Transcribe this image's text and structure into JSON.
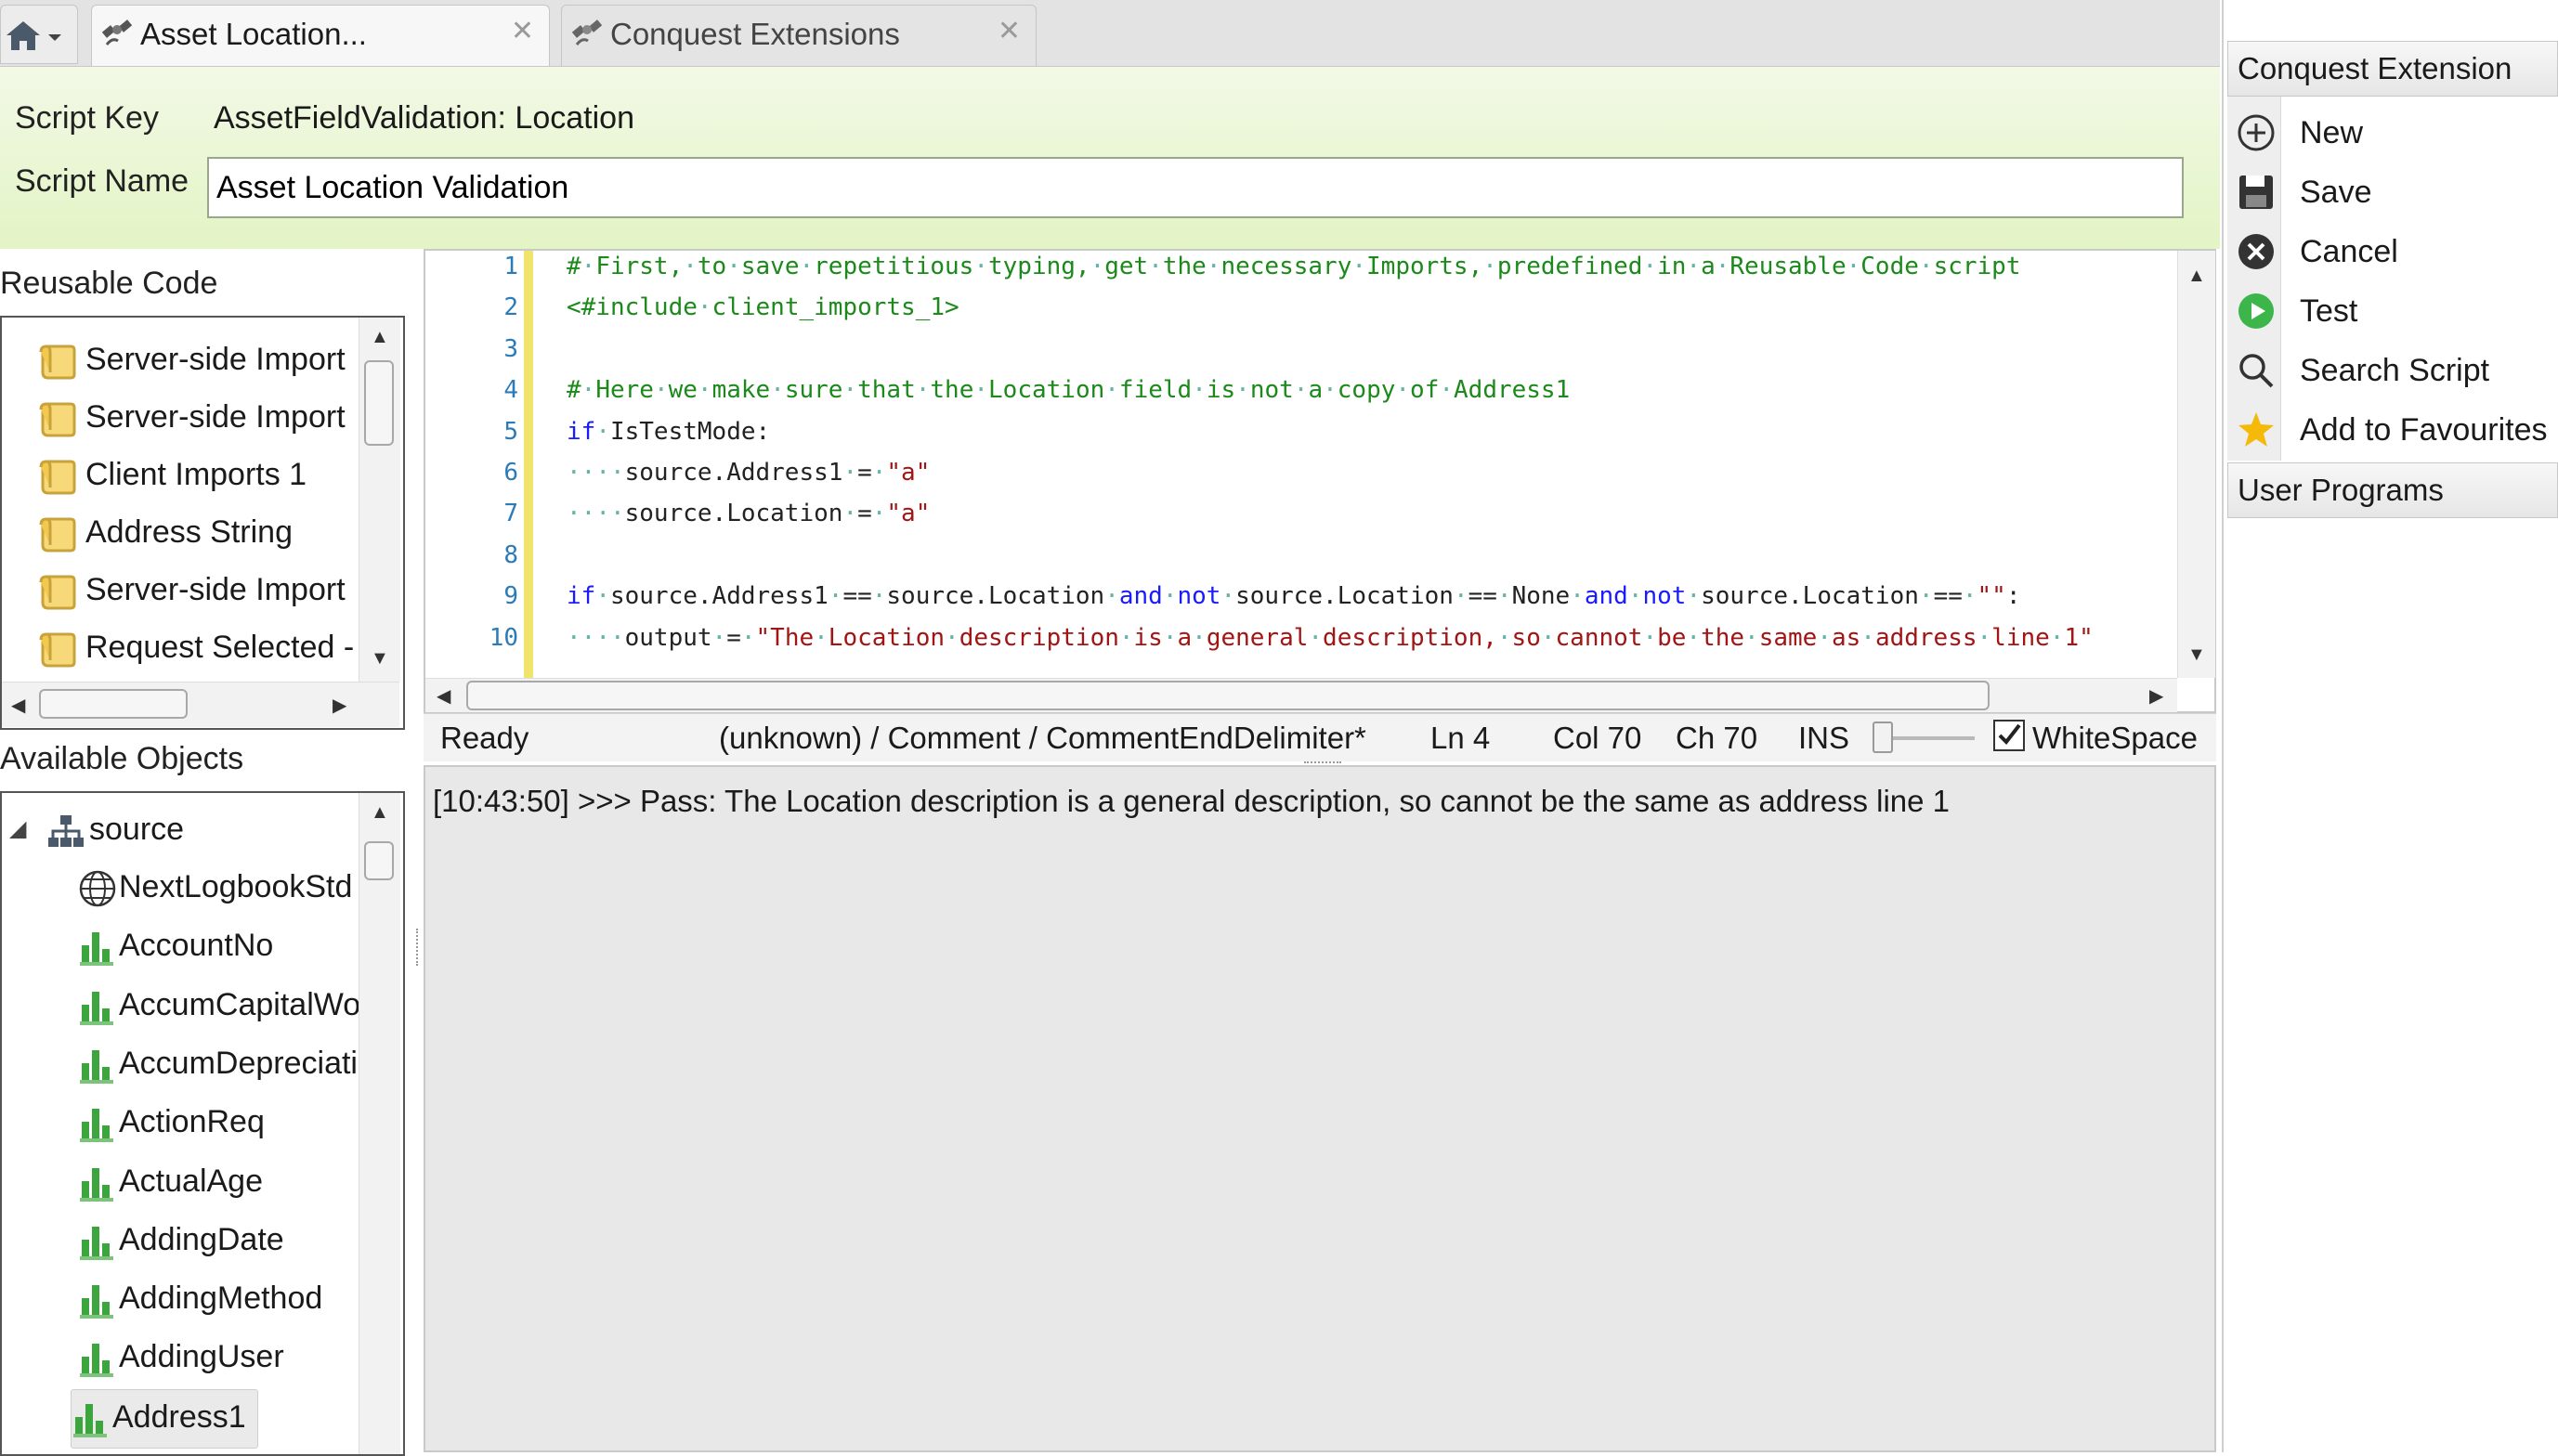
{
  "tabs": [
    {
      "label": "Asset Location...",
      "close": "✕"
    },
    {
      "label": "Conquest Extensions",
      "close": "✕"
    }
  ],
  "header": {
    "script_key_label": "Script Key",
    "script_key_value": "AssetFieldValidation: Location",
    "script_name_label": "Script Name",
    "script_name_value": "Asset Location Validation"
  },
  "reusable_code": {
    "title": "Reusable Code",
    "items": [
      "Server-side Import",
      "Server-side Import",
      "Client Imports 1",
      "Address String",
      "Server-side Import",
      "Request Selected -"
    ]
  },
  "available_objects": {
    "title": "Available Objects",
    "root": "source",
    "items": [
      "NextLogbookStd",
      "AccountNo",
      "AccumCapitalWo",
      "AccumDepreciati",
      "ActionReq",
      "ActualAge",
      "AddingDate",
      "AddingMethod",
      "AddingUser",
      "Address1"
    ],
    "selected": "Address1"
  },
  "editor": {
    "line_numbers": [
      "1",
      "2",
      "3",
      "4",
      "5",
      "6",
      "7",
      "8",
      "9",
      "10"
    ],
    "lines": [
      "# First, to save repetitious typing, get the necessary Imports, predefined in a Reusable Code script",
      "<#include client_imports_1>",
      "",
      "# Here we make sure that the Location field is not a copy of Address1",
      "if IsTestMode:",
      "    source.Address1 = \"a\"",
      "    source.Location = \"a\"",
      "",
      "if source.Address1 == source.Location and not source.Location == None and not source.Location == \"\":",
      "    output = \"The Location description is a general description, so cannot be the same as address line 1\""
    ]
  },
  "status_bar": {
    "state": "Ready",
    "context": "(unknown) / Comment / CommentEndDelimiter*",
    "line": "Ln 4",
    "col": "Col 70",
    "ch": "Ch 70",
    "mode": "INS",
    "whitespace_label": "WhiteSpace",
    "whitespace_checked": true
  },
  "output": {
    "text": "[10:43:50] >>> Pass: The Location description is a general description, so cannot be the same as address line 1"
  },
  "right_panel": {
    "section_title": "Conquest Extension",
    "actions": [
      {
        "label": "New",
        "icon": "add-circle-icon"
      },
      {
        "label": "Save",
        "icon": "floppy-disk-icon"
      },
      {
        "label": "Cancel",
        "icon": "cancel-circle-icon"
      },
      {
        "label": "Test",
        "icon": "play-icon"
      },
      {
        "label": "Search Script",
        "icon": "magnifier-icon"
      },
      {
        "label": "Add to Favourites",
        "icon": "star-icon"
      }
    ],
    "section2_title": "User Programs"
  },
  "colors": {
    "header_green": "#e3f4c5",
    "gutter_yellow": "#f1e46c",
    "comment_green": "#1b8a1b",
    "keyword_blue": "#1a1aff",
    "string_red": "#a31515"
  }
}
